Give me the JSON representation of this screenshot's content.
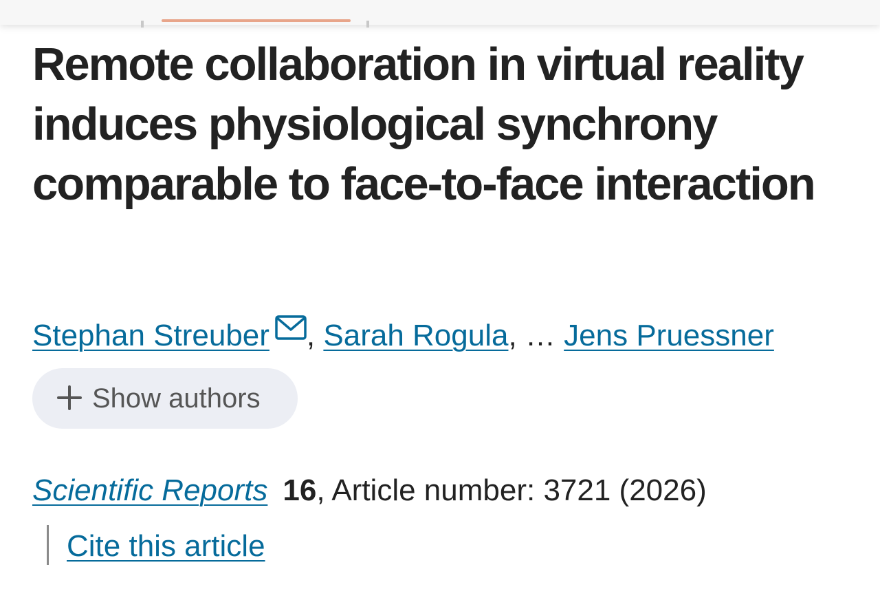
{
  "article": {
    "title": "Remote collaboration in virtual reality induces physiological synchrony comparable to face-to-face interaction"
  },
  "authors": {
    "first": "Stephan Streuber",
    "second": "Sarah Rogula",
    "comma": ",",
    "ellipsis": "…",
    "last": "Jens Pruessner",
    "contact_icon": "mail-icon"
  },
  "show_authors": {
    "label": "Show authors",
    "icon": "plus-icon"
  },
  "citation": {
    "journal": "Scientific Reports",
    "volume": "16",
    "details": ", Article number: 3721 (2026)"
  },
  "cite": {
    "label": "Cite this article"
  },
  "colors": {
    "link": "#066b9b",
    "text": "#222222",
    "button_bg": "#eceef4",
    "top_accent": "#e8a58a"
  }
}
